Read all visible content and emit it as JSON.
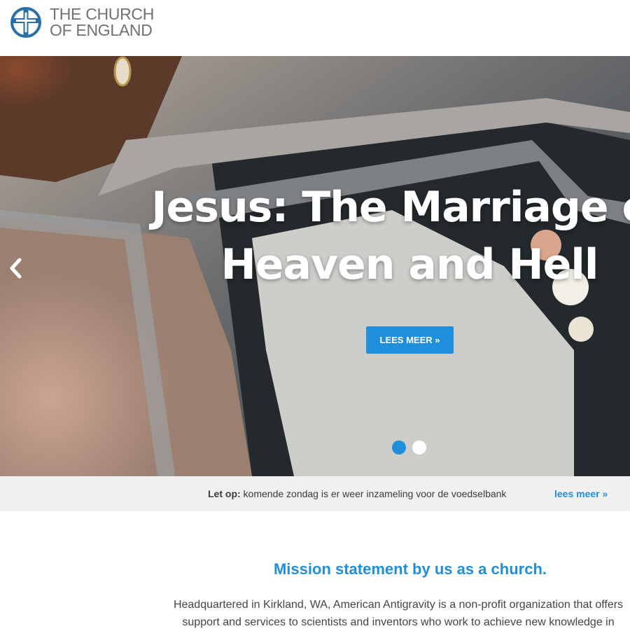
{
  "header": {
    "logo_line1": "THE CHURCH",
    "logo_line2": "OF ENGLAND",
    "logo_color": "#2a6fa8"
  },
  "hero": {
    "title_line1": "Jesus: The Marriage of",
    "title_line2": "Heaven and Hell",
    "button_label": "LEES MEER »",
    "prev_icon": "chevron-left-icon",
    "slides_total": 2,
    "active_slide": 1,
    "accent_color": "#1f8fdb"
  },
  "notice": {
    "label": "Let op:",
    "text": " komende zondag is er weer inzameling voor de voedselbank",
    "link": "lees meer »"
  },
  "mission": {
    "title": "Mission statement by us as a church.",
    "line1": "Headquartered in Kirkland, WA, American Antigravity is a non-profit organization that offers",
    "line2": "support and services to scientists and inventors who work to achieve new knowledge in"
  }
}
